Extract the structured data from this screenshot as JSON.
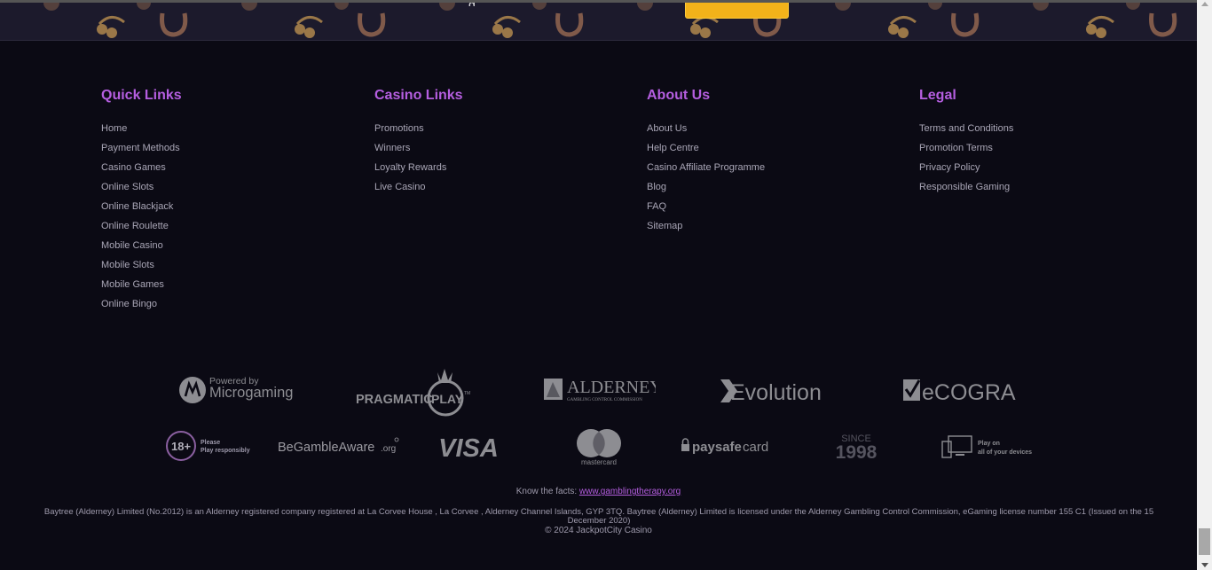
{
  "banner": {
    "title_fragment": "g",
    "button_label": ""
  },
  "footer": {
    "columns": [
      {
        "heading": "Quick Links",
        "links": [
          "Home",
          "Payment Methods",
          "Casino Games",
          "Online Slots",
          "Online Blackjack",
          "Online Roulette",
          "Mobile Casino",
          "Mobile Slots",
          "Mobile Games",
          "Online Bingo"
        ]
      },
      {
        "heading": "Casino Links",
        "links": [
          "Promotions",
          "Winners",
          "Loyalty Rewards",
          "Live Casino"
        ]
      },
      {
        "heading": "About Us",
        "links": [
          "About Us",
          "Help Centre",
          "Casino Affiliate Programme",
          "Blog",
          "FAQ",
          "Sitemap"
        ]
      },
      {
        "heading": "Legal",
        "links": [
          "Terms and Conditions",
          "Promotion Terms",
          "Privacy Policy",
          "Responsible Gaming"
        ]
      }
    ],
    "providers": {
      "microgaming_small": "Powered by",
      "microgaming_big": "Microgaming",
      "pragmatic": "PRAGMATIC",
      "pragmatic_play": "PLAY",
      "pragmatic_tm": "TM",
      "alderney": "ALDERNEY",
      "alderney_sub": "GAMBLING CONTROL COMMISSION",
      "evolution": "Evolution",
      "ecogra": "eCOGRA"
    },
    "badges": {
      "age": "18+",
      "age_line1": "Please",
      "age_line2": "Play responsibly",
      "begambleaware": "BeGambleAware",
      "begambleaware_suffix": ".org",
      "visa": "VISA",
      "mastercard": "mastercard",
      "paysafe_bold": "paysafe",
      "paysafe_light": "card",
      "since": "SINCE",
      "since_year": "1998",
      "devices_line1": "Play on",
      "devices_line2": "all of your devices"
    },
    "facts_text": "Know the facts: ",
    "facts_link": "www.gamblingtherapy.org",
    "legal_text": "Baytree (Alderney) Limited (No.2012) is an Alderney registered company registered at La Corvee House , La Corvee , Alderney Channel Islands, GYP 3TQ. Baytree (Alderney) Limited is licensed under the Alderney Gambling Control Commission, eGaming license number 155 C1 (Issued on the 15 December 2020)",
    "copyright": "© 2024 JackpotCity Casino"
  },
  "colors": {
    "background": "#0b0a14",
    "heading_accent": "#b55ee0",
    "link": "#a9a6b6",
    "banner_button": "#f2b21a"
  }
}
